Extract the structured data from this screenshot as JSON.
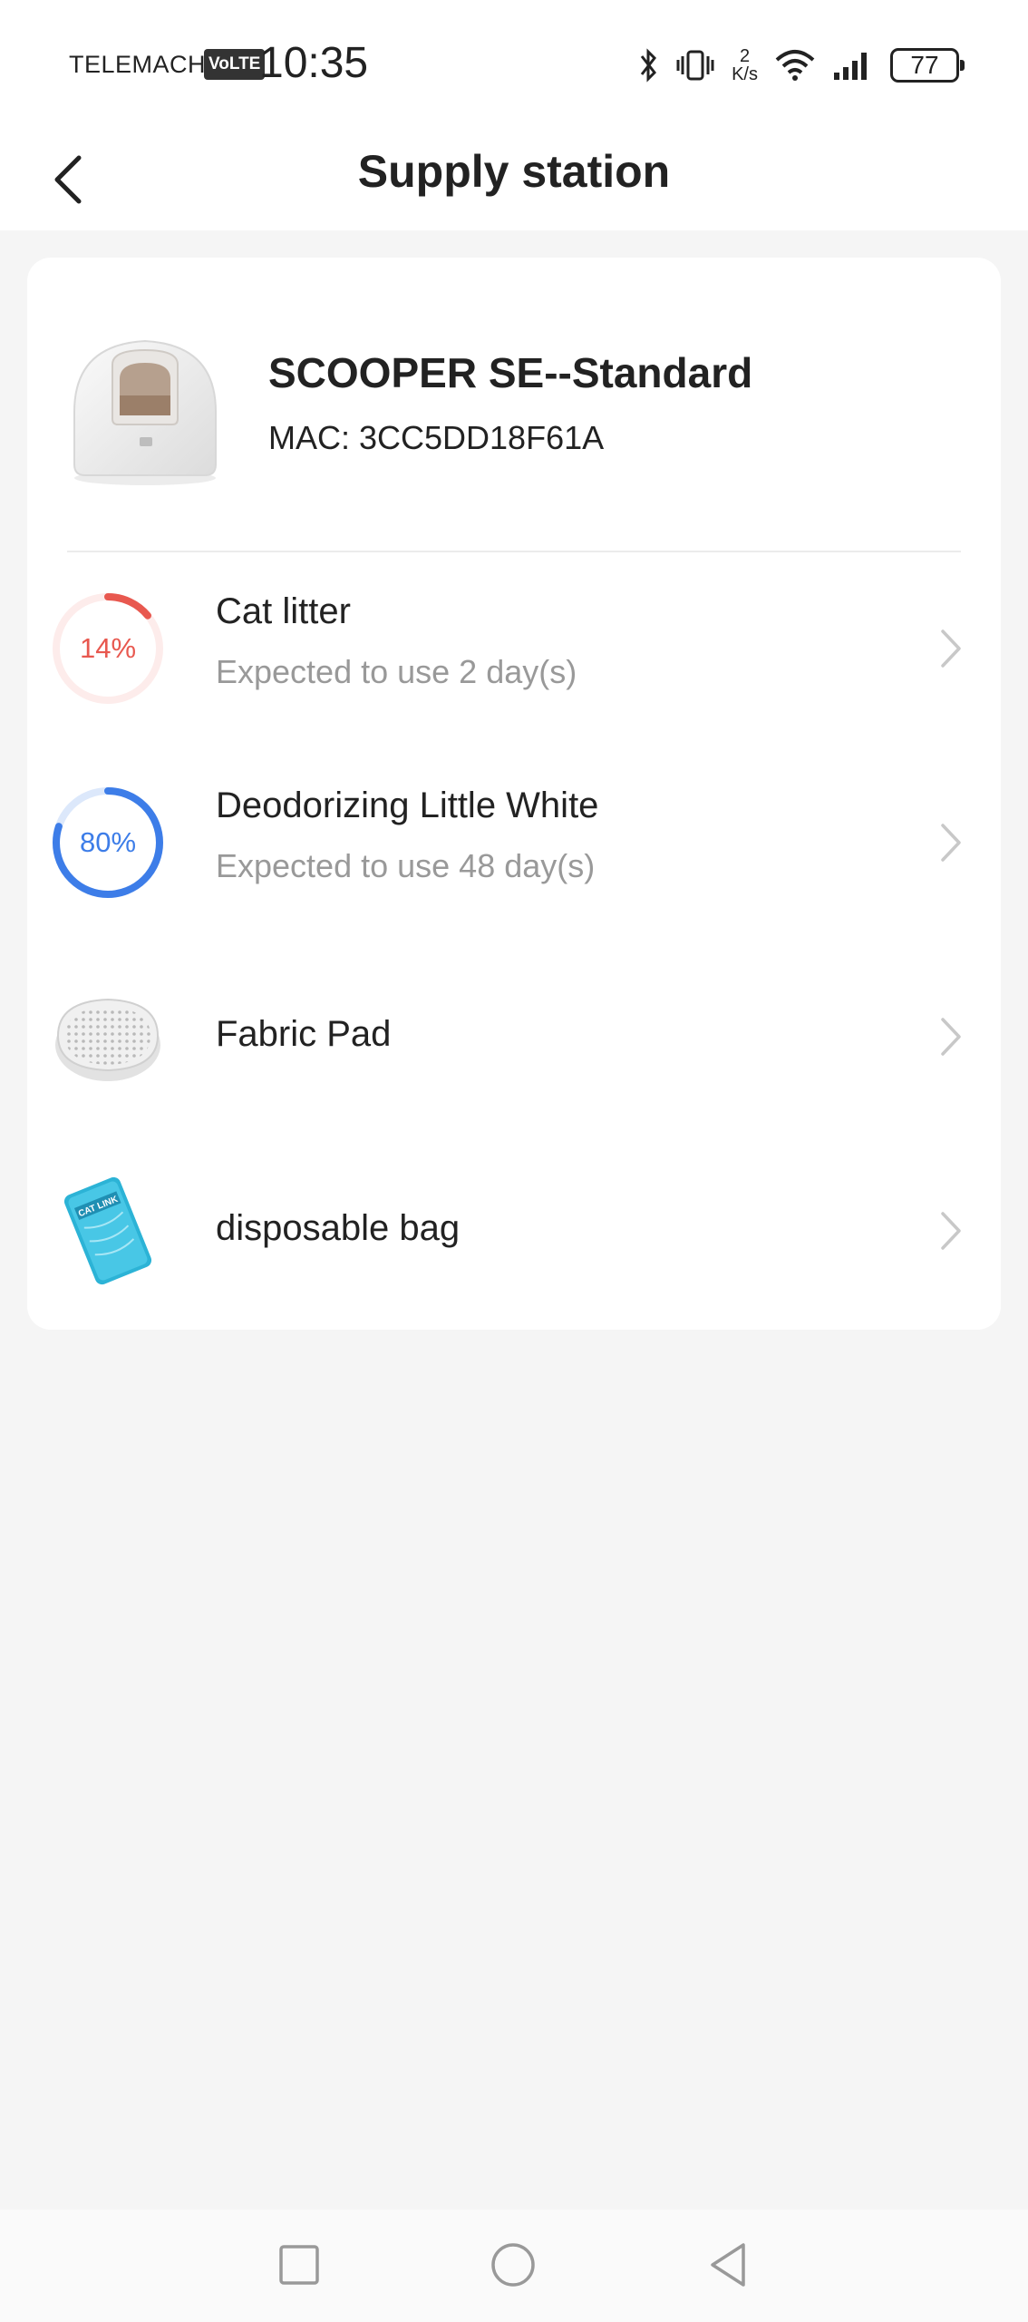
{
  "status_bar": {
    "carrier": "TELEMACH",
    "volte": "VoLTE",
    "time": "10:35",
    "speed_value": "2",
    "speed_unit": "K/s",
    "battery": "77"
  },
  "header": {
    "title": "Supply station"
  },
  "device": {
    "name": "SCOOPER SE--Standard",
    "mac": "MAC: 3CC5DD18F61A"
  },
  "supplies": [
    {
      "name": "Cat litter",
      "percent_label": "14%",
      "percent": 14,
      "expected": "Expected to use 2 day(s)",
      "color": "#e8584f",
      "track_color": "#fdeceb"
    },
    {
      "name": "Deodorizing Little White",
      "percent_label": "80%",
      "percent": 80,
      "expected": "Expected to use 48 day(s)",
      "color": "#3d7de8",
      "track_color": "#dce8fb"
    },
    {
      "name": "Fabric Pad"
    },
    {
      "name": "disposable bag",
      "icon_text": "CAT LINK"
    }
  ]
}
